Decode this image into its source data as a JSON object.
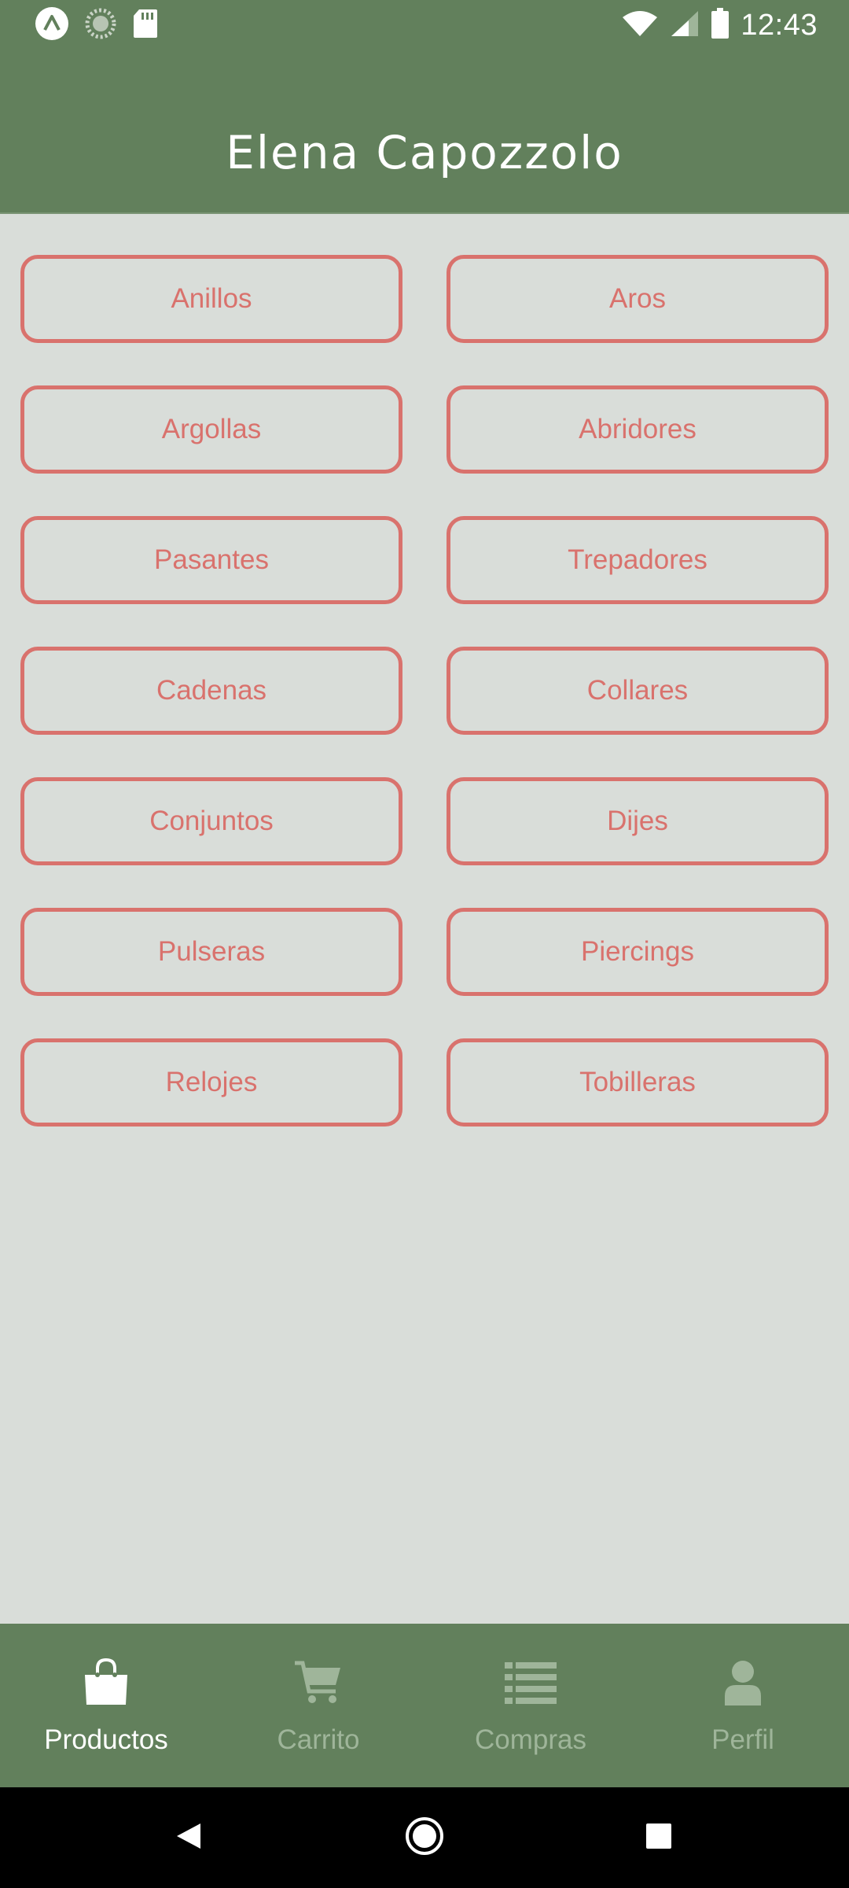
{
  "status_bar": {
    "time": "12:43",
    "icons": [
      "app-logo-icon",
      "sync-icon",
      "sd-card-icon",
      "wifi-icon",
      "signal-icon",
      "battery-icon"
    ]
  },
  "header": {
    "title": "Elena Capozzolo"
  },
  "categories": [
    "Anillos",
    "Aros",
    "Argollas",
    "Abridores",
    "Pasantes",
    "Trepadores",
    "Cadenas",
    "Collares",
    "Conjuntos",
    "Dijes",
    "Pulseras",
    "Piercings",
    "Relojes",
    "Tobilleras"
  ],
  "bottom_nav": {
    "items": [
      {
        "label": "Productos",
        "icon": "shopping-bag-icon",
        "active": true
      },
      {
        "label": "Carrito",
        "icon": "cart-icon",
        "active": false
      },
      {
        "label": "Compras",
        "icon": "list-icon",
        "active": false
      },
      {
        "label": "Perfil",
        "icon": "person-icon",
        "active": false
      }
    ]
  },
  "colors": {
    "primary": "#62805c",
    "accent": "#d9726d",
    "background": "#d9ddd9",
    "nav_inactive": "#9fb59a"
  }
}
